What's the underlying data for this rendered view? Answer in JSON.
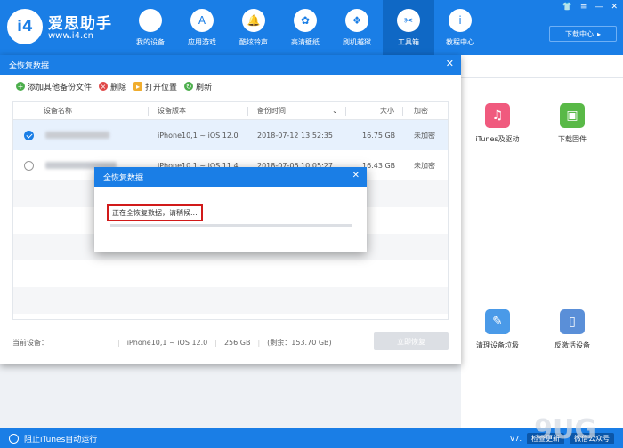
{
  "app": {
    "title": "爱思助手",
    "url": "www.i4.cn",
    "logo_text": "i4",
    "download_center": "下载中心"
  },
  "nav": [
    {
      "label": "我的设备",
      "icon": ""
    },
    {
      "label": "应用游戏",
      "icon": "A"
    },
    {
      "label": "酷炫铃声",
      "icon": "🔔"
    },
    {
      "label": "高清壁纸",
      "icon": "✿"
    },
    {
      "label": "刷机越狱",
      "icon": "❖"
    },
    {
      "label": "工具箱",
      "icon": "✂"
    },
    {
      "label": "教程中心",
      "icon": "i"
    }
  ],
  "tools": [
    {
      "label": "iTunes及驱动",
      "icon": "♫",
      "color": "#f05a7e"
    },
    {
      "label": "下载固件",
      "icon": "▣",
      "color": "#59b947"
    },
    {
      "label": "清理设备垃圾",
      "icon": "✎",
      "color": "#4a9ae8"
    },
    {
      "label": "反激活设备",
      "icon": "▯",
      "color": "#5a8fd8"
    }
  ],
  "statusbar": {
    "left": "阻止iTunes自动运行",
    "version": "V7.",
    "badge1": "检查更新",
    "badge2": "微信公众号"
  },
  "watermark": "9UG",
  "dialog": {
    "title": "全恢复数据",
    "toolbar": [
      {
        "label": "添加其他备份文件",
        "icon": "+",
        "color": "#4cae4c"
      },
      {
        "label": "删除",
        "icon": "×",
        "color": "#e04848"
      },
      {
        "label": "打开位置",
        "icon": "▸",
        "color": "#f0ad2e"
      },
      {
        "label": "刷新",
        "icon": "↻",
        "color": "#4cae4c"
      }
    ],
    "columns": [
      "设备名称",
      "设备版本",
      "备份时间",
      "大小",
      "加密"
    ],
    "rows": [
      {
        "version": "iPhone10,1 ~ iOS 12.0",
        "time": "2018-07-12 13:52:35",
        "size": "16.75 GB",
        "encrypt": "未加密",
        "selected": true
      },
      {
        "version": "iPhone10,1 ~ iOS 11.4",
        "time": "2018-07-06 10:05:27",
        "size": "16.43 GB",
        "encrypt": "未加密",
        "selected": false
      }
    ],
    "footer": {
      "label": "当前设备：",
      "device": "iPhone10,1 ~ iOS 12.0",
      "capacity": "256 GB",
      "remaining": "(剩余：153.70 GB)",
      "restore_button": "立即恢复"
    }
  },
  "modal": {
    "title": "全恢复数据",
    "message": "正在全恢复数据，请稍候...",
    "progress": 0.0
  }
}
